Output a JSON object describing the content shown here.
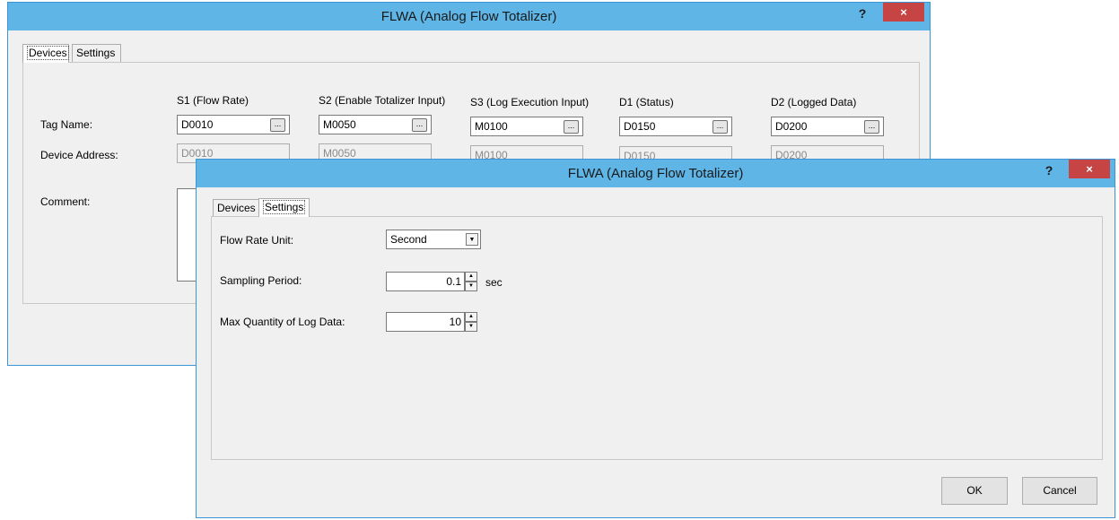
{
  "back_dialog": {
    "title": "FLWA (Analog Flow Totalizer)",
    "help": "?",
    "close": "×",
    "tabs": [
      "Devices",
      "Settings"
    ],
    "row_labels": {
      "tag_name": "Tag Name:",
      "device_address": "Device Address:",
      "comment": "Comment:"
    },
    "columns": [
      {
        "header": "S1 (Flow Rate)",
        "tag": "D0010",
        "address": "D0010"
      },
      {
        "header": "S2 (Enable Totalizer Input)",
        "tag": "M0050",
        "address": "M0050"
      },
      {
        "header": "S3 (Log Execution Input)",
        "tag": "M0100",
        "address": "M0100"
      },
      {
        "header": "D1 (Status)",
        "tag": "D0150",
        "address": "D0150"
      },
      {
        "header": "D2 (Logged Data)",
        "tag": "D0200",
        "address": "D0200"
      }
    ],
    "browse_label": "..."
  },
  "front_dialog": {
    "title": "FLWA (Analog Flow Totalizer)",
    "help": "?",
    "close": "×",
    "tabs": [
      "Devices",
      "Settings"
    ],
    "flow_rate_unit": {
      "label": "Flow Rate Unit:",
      "value": "Second"
    },
    "sampling_period": {
      "label": "Sampling Period:",
      "value": "0.1",
      "unit": "sec"
    },
    "max_log": {
      "label": "Max Quantity of Log Data:",
      "value": "10"
    },
    "ok_label": "OK",
    "cancel_label": "Cancel"
  },
  "icons": {
    "dropdown": "▼",
    "spin_up": "▲",
    "spin_down": "▼"
  },
  "colors": {
    "titlebar": "#5eb5e6",
    "close": "#c74444",
    "window_border": "#3c96d6"
  }
}
